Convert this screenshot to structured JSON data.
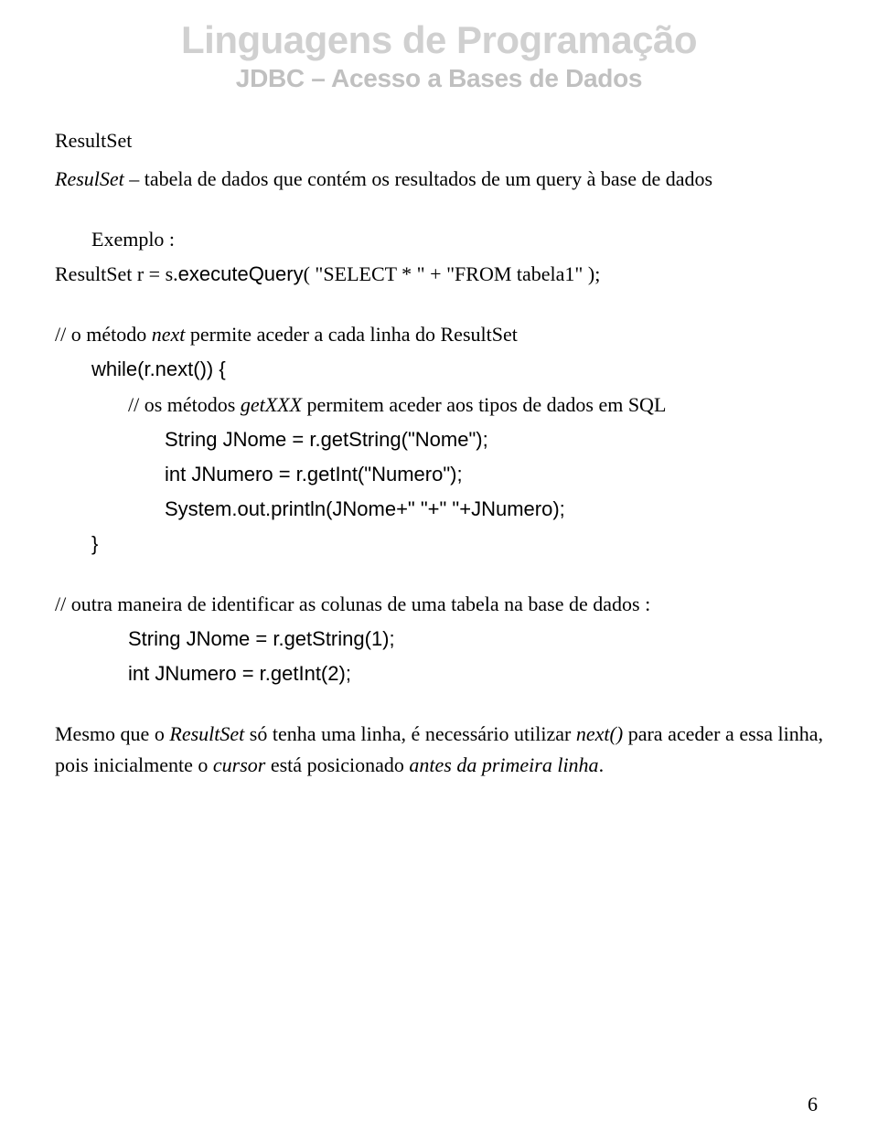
{
  "header": {
    "title": "Linguagens de Programação",
    "subtitle": "JDBC – Acesso a Bases de Dados"
  },
  "body": {
    "h_resultset": "ResultSet",
    "desc_prefix": "ResulSet",
    "desc_rest": " – tabela de dados que contém os resultados de um query à base de dados",
    "exemplo": "Exemplo :",
    "exec_pre": "ResultSet r = s.",
    "exec_sans": "executeQuery",
    "exec_post": "( \"SELECT * \" + \"FROM tabela1\" );",
    "c1_pre": "// o método ",
    "c1_it": "next",
    "c1_post": " permite aceder a cada linha do ResultSet",
    "while_line": "while(r.next()) {",
    "c2_pre": "// os métodos ",
    "c2_it": "getXXX",
    "c2_post": " permitem aceder aos tipos de dados em SQL",
    "blk1": "String JNome = r.getString(\"Nome\");",
    "blk2": "int JNumero = r.getInt(\"Numero\");",
    "blk3": "System.out.println(JNome+\" \"+\" \"+JNumero);",
    "close_brace": "}",
    "c3": "// outra maneira de identificar as colunas de uma tabela na base de dados :",
    "blk4": "String JNome = r.getString(1);",
    "blk5": "int JNumero = r.getInt(2);",
    "p_final_1a": "Mesmo que o ",
    "p_final_1b": "ResultSet",
    "p_final_1c": " só tenha uma linha, é necessário utilizar ",
    "p_final_1d": "next()",
    "p_final_1e": " para aceder a essa linha, pois inicialmente o ",
    "p_final_1f": "cursor",
    "p_final_1g": " está posicionado ",
    "p_final_1h": "antes da primeira linha",
    "p_final_1i": "."
  },
  "page_number": "6"
}
